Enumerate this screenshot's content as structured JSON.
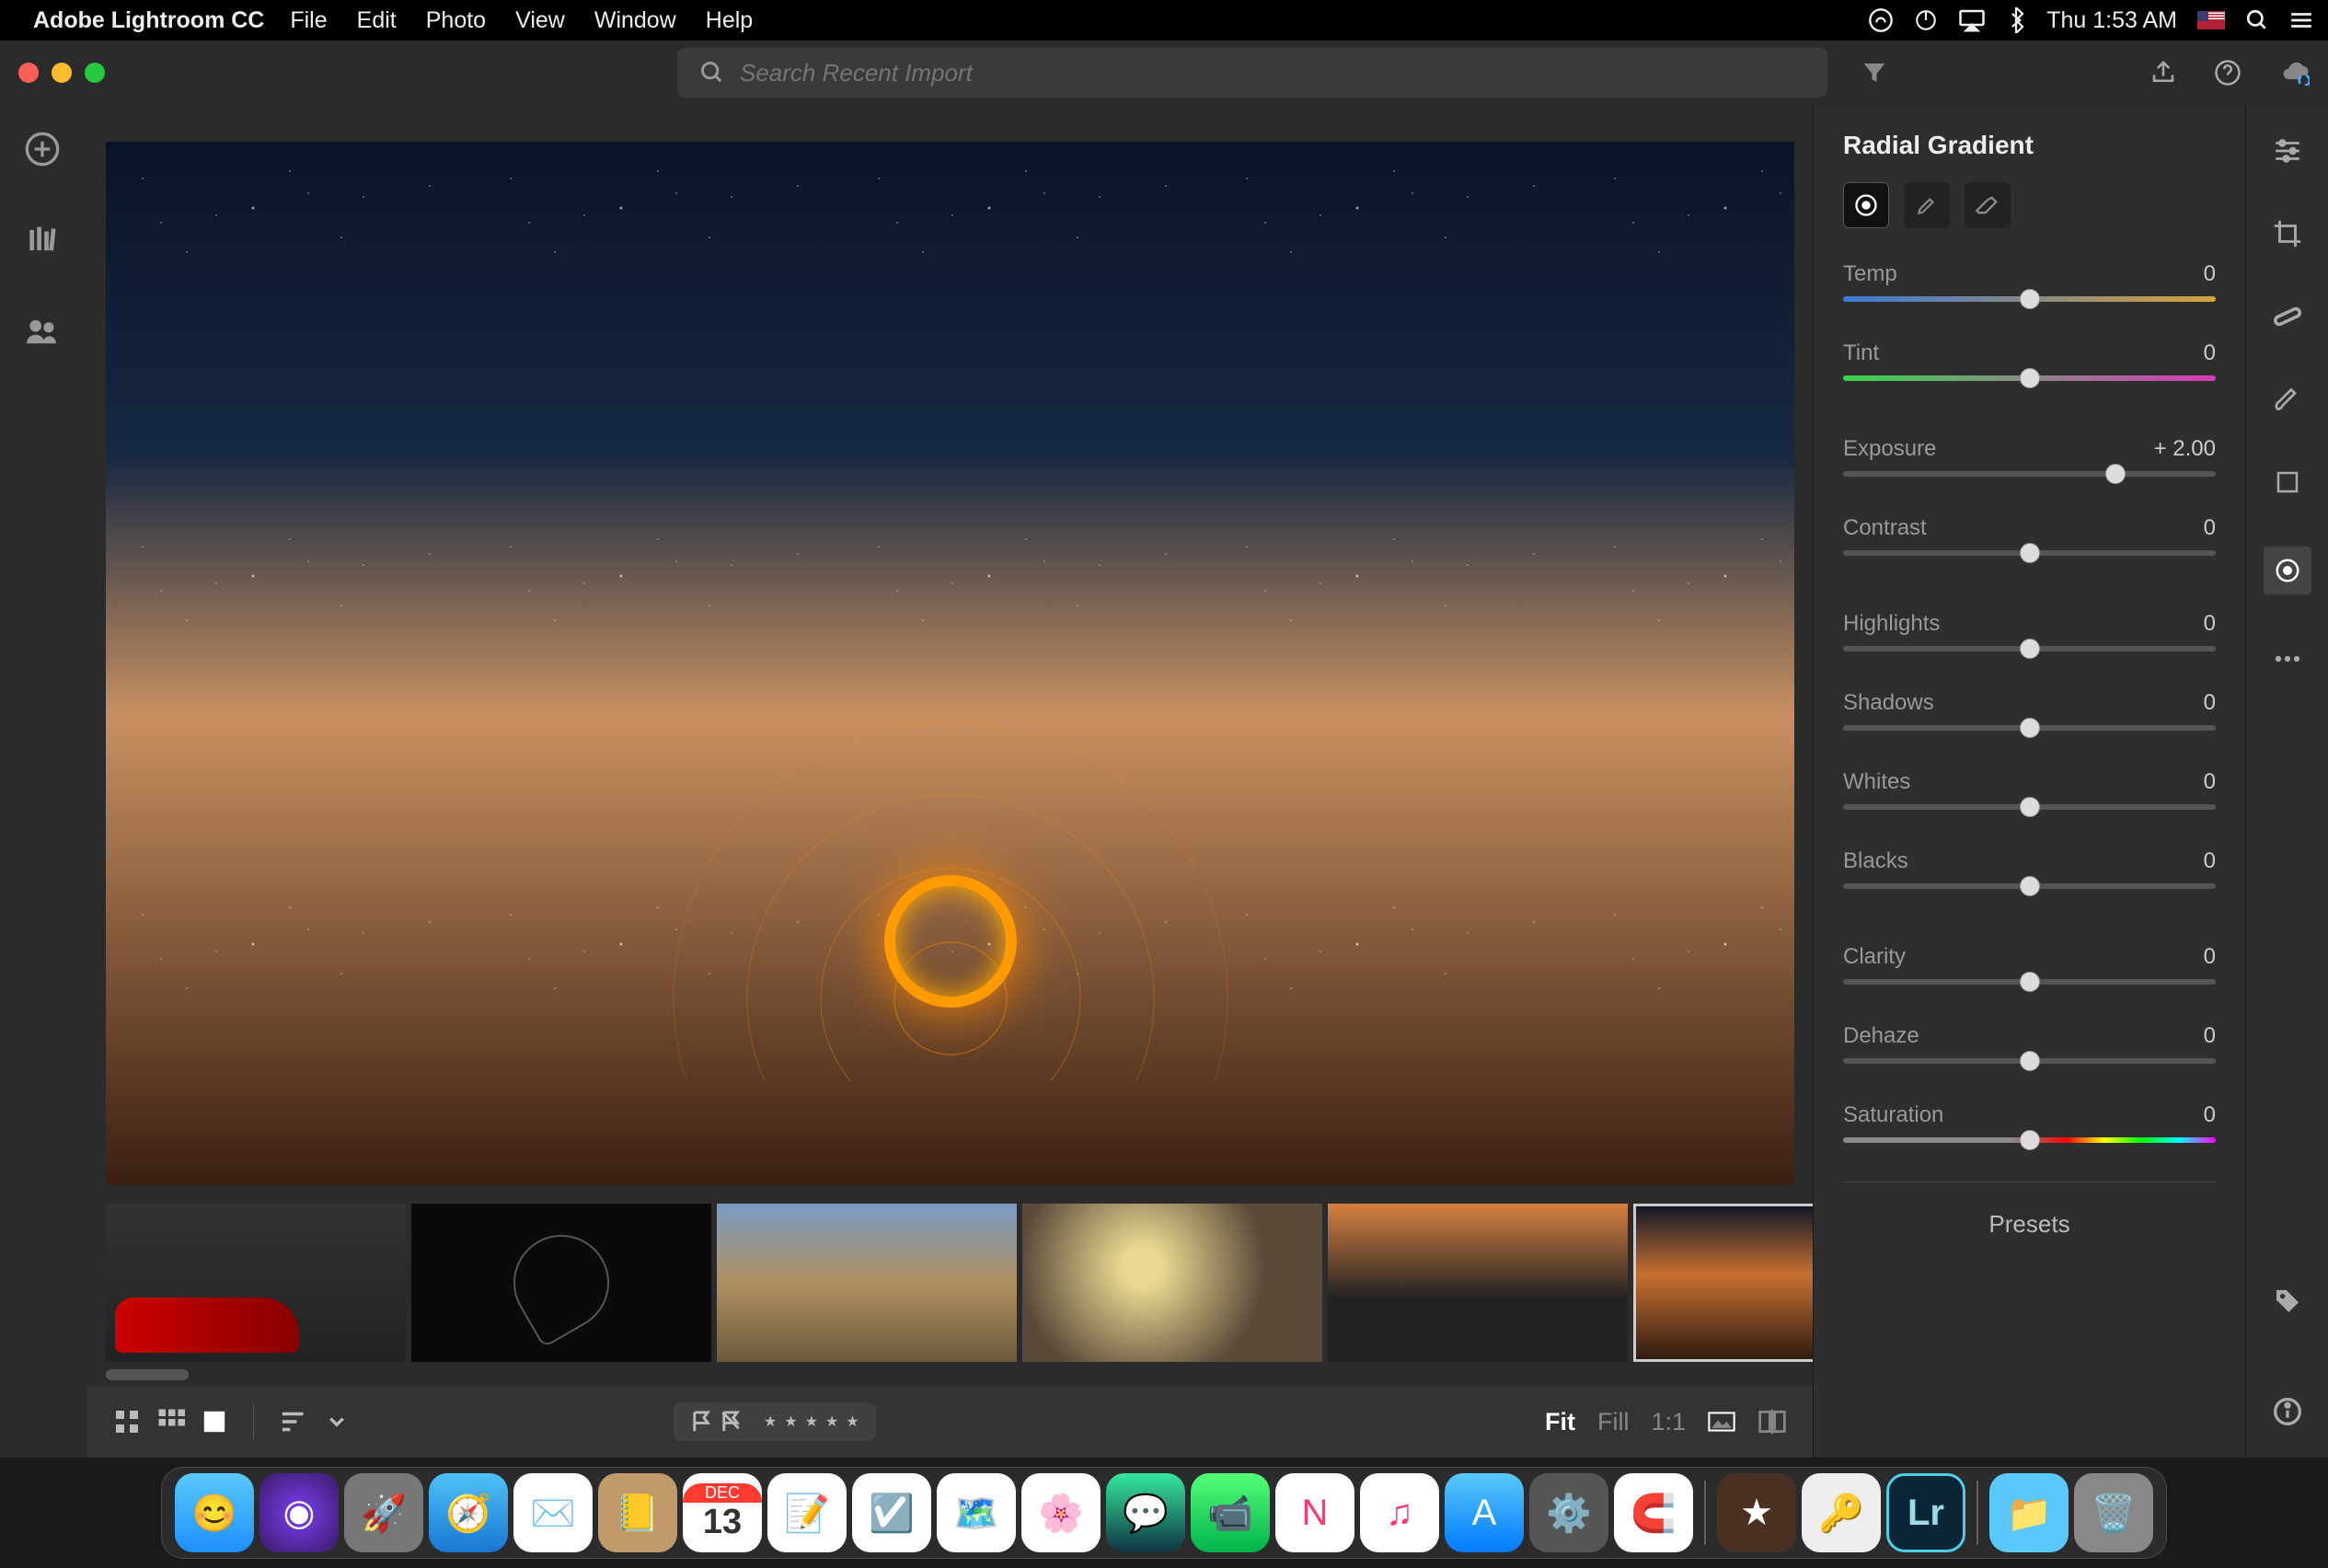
{
  "menubar": {
    "app_name": "Adobe Lightroom CC",
    "items": [
      "File",
      "Edit",
      "Photo",
      "View",
      "Window",
      "Help"
    ],
    "clock": "Thu 1:53 AM"
  },
  "search": {
    "placeholder": "Search Recent Import"
  },
  "panel": {
    "title": "Radial Gradient",
    "sliders": [
      {
        "name": "Temp",
        "value": "0",
        "pos": 50,
        "track": "temp"
      },
      {
        "name": "Tint",
        "value": "0",
        "pos": 50,
        "track": "tint"
      },
      {
        "name": "Exposure",
        "value": "+ 2.00",
        "pos": 73,
        "track": "plain",
        "gap_before": true
      },
      {
        "name": "Contrast",
        "value": "0",
        "pos": 50,
        "track": "plain"
      },
      {
        "name": "Highlights",
        "value": "0",
        "pos": 50,
        "track": "plain",
        "gap_before": true
      },
      {
        "name": "Shadows",
        "value": "0",
        "pos": 50,
        "track": "plain"
      },
      {
        "name": "Whites",
        "value": "0",
        "pos": 50,
        "track": "plain"
      },
      {
        "name": "Blacks",
        "value": "0",
        "pos": 50,
        "track": "plain"
      },
      {
        "name": "Clarity",
        "value": "0",
        "pos": 50,
        "track": "plain",
        "gap_before": true
      },
      {
        "name": "Dehaze",
        "value": "0",
        "pos": 50,
        "track": "plain"
      },
      {
        "name": "Saturation",
        "value": "0",
        "pos": 50,
        "track": "sat"
      }
    ],
    "presets": "Presets"
  },
  "zoom": {
    "fit": "Fit",
    "fill": "Fill",
    "one": "1:1"
  },
  "thumbnails": [
    {
      "desc": "red-sports-car"
    },
    {
      "desc": "apple-logo-dark"
    },
    {
      "desc": "mountain-landscape"
    },
    {
      "desc": "coffee-beans"
    },
    {
      "desc": "ocean-sunset"
    },
    {
      "desc": "steel-wool-sparks",
      "selected": true
    }
  ],
  "dock_apps": [
    "finder",
    "siri",
    "launchpad",
    "safari",
    "mail",
    "contacts",
    "calendar",
    "notes",
    "reminders",
    "maps",
    "photos",
    "messages",
    "facetime",
    "news",
    "itunes",
    "appstore",
    "preferences",
    "magnet",
    "divider",
    "imovie",
    "1password",
    "lightroom",
    "divider",
    "downloads",
    "trash"
  ],
  "calendar_icon": {
    "month": "DEC",
    "day": "13"
  }
}
